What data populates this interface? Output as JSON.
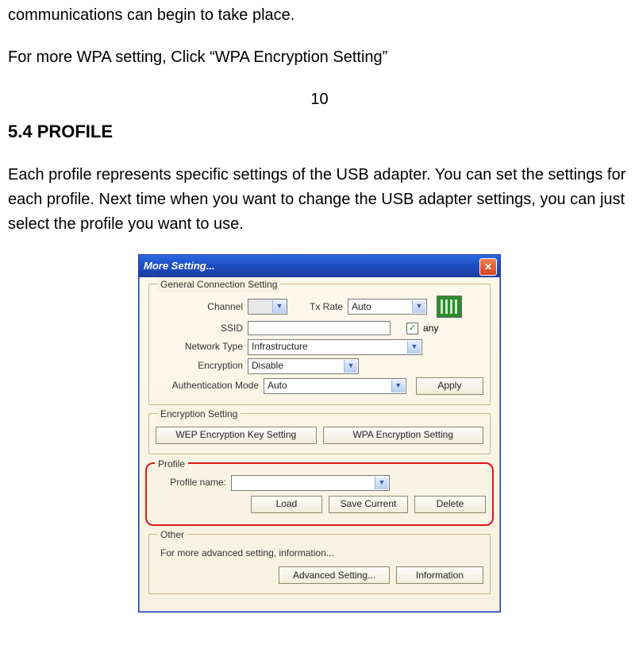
{
  "doc": {
    "line1": "communications can begin to take place.",
    "line2": "For more WPA setting, Click “WPA Encryption Setting”",
    "page_num": "10",
    "heading": "5.4 PROFILE",
    "body": "Each profile represents specific settings of the USB adapter. You can set the settings for each profile. Next time when you want to change the USB adapter settings, you can just select the profile you want to use."
  },
  "dialog": {
    "title": "More Setting...",
    "close_glyph": "✕",
    "groups": {
      "general": {
        "legend": "General Connection Setting",
        "channel_label": "Channel",
        "channel_value": "",
        "txrate_label": "Tx Rate",
        "txrate_value": "Auto",
        "ssid_label": "SSID",
        "ssid_value": "",
        "any_checked": "✓",
        "any_label": "any",
        "network_type_label": "Network Type",
        "network_type_value": "Infrastructure",
        "encryption_label": "Encryption",
        "encryption_value": "Disable",
        "auth_label": "Authentication Mode",
        "auth_value": "Auto",
        "apply_label": "Apply"
      },
      "encryption": {
        "legend": "Encryption Setting",
        "wep_btn": "WEP Encryption Key Setting",
        "wpa_btn": "WPA Encryption Setting"
      },
      "profile": {
        "legend": "Profile",
        "name_label": "Profile name:",
        "name_value": "",
        "load_btn": "Load",
        "save_btn": "Save Current",
        "delete_btn": "Delete"
      },
      "other": {
        "legend": "Other",
        "text": "For more advanced setting, information...",
        "advanced_btn": "Advanced Setting...",
        "info_btn": "Information"
      }
    },
    "arrow_glyph": "▼"
  }
}
